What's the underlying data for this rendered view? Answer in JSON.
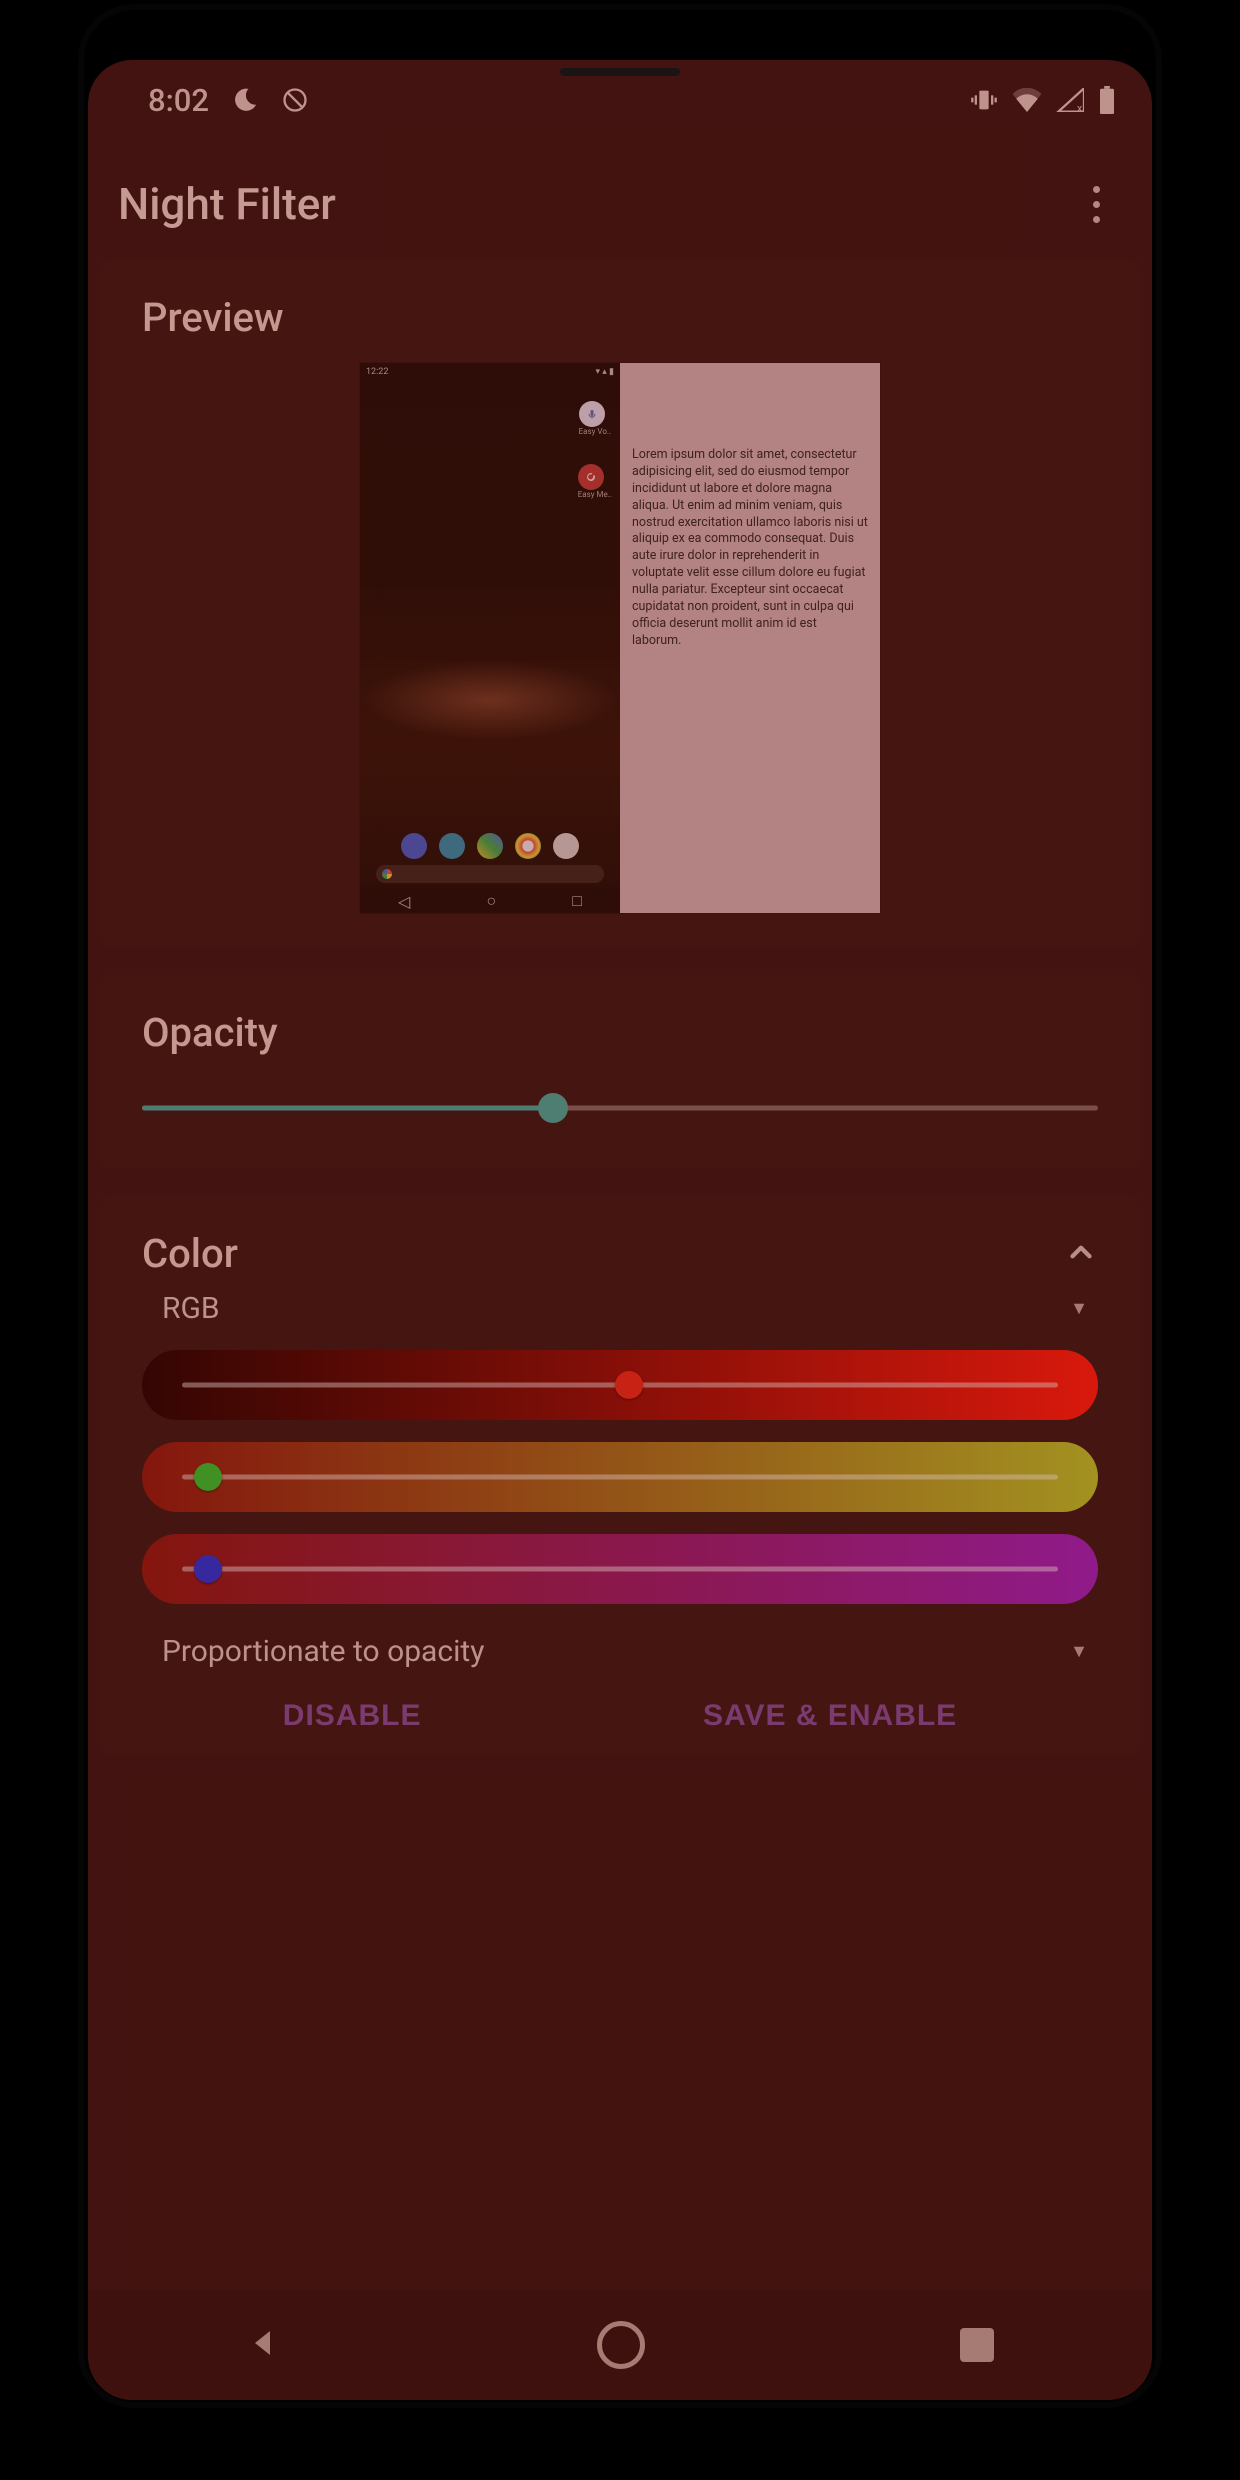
{
  "statusbar": {
    "time": "8:02"
  },
  "appbar": {
    "title": "Night Filter"
  },
  "preview": {
    "heading": "Preview",
    "phone_time": "12:22",
    "bubble1_label": "Easy Vo..",
    "bubble2_label": "Easy Me..",
    "lorem": "Lorem ipsum dolor sit amet, consectetur adipisicing elit, sed do eiusmod tempor incididunt ut labore et dolore magna aliqua. Ut enim ad minim veniam, quis nostrud exercitation ullamco laboris nisi ut aliquip ex ea commodo consequat. Duis aute irure dolor in reprehenderit in voluptate velit esse cillum dolore eu fugiat nulla pariatur. Excepteur sint occaecat cupidatat non proident, sunt in culpa qui officia deserunt mollit anim id est laborum."
  },
  "opacity": {
    "heading": "Opacity",
    "value_pct": 43
  },
  "color": {
    "heading": "Color",
    "mode": "RGB",
    "red_pct": 51,
    "green_pct": 3,
    "blue_pct": 3,
    "behavior": "Proportionate to opacity"
  },
  "actions": {
    "disable": "DISABLE",
    "save_enable": "SAVE & ENABLE"
  }
}
